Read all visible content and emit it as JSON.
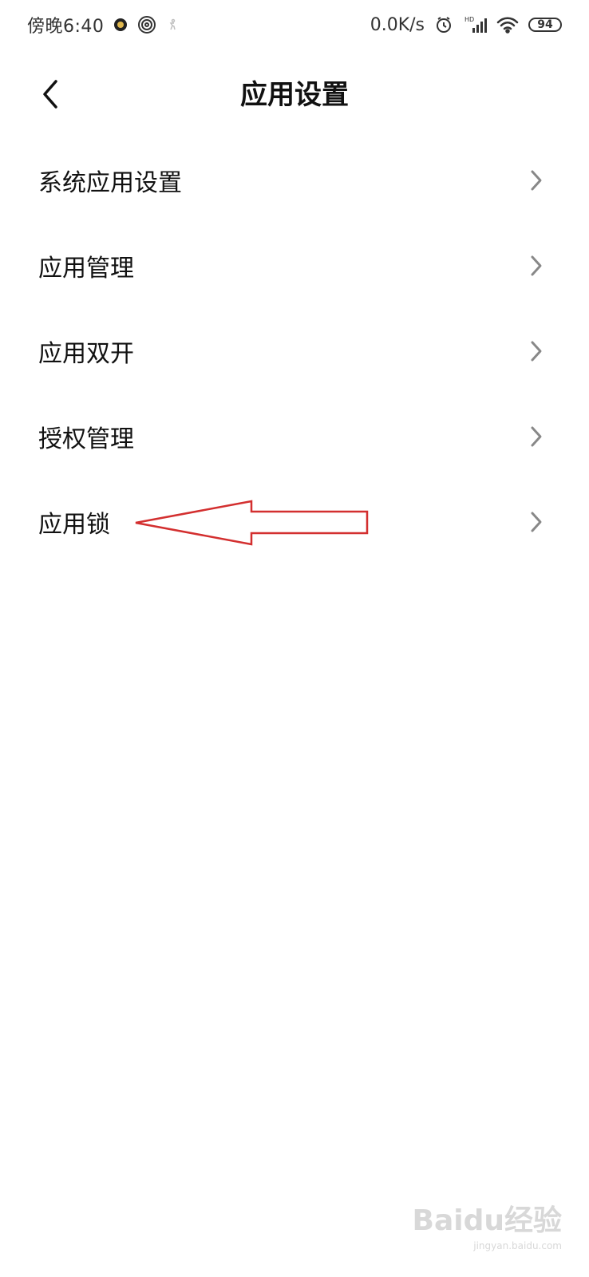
{
  "status_bar": {
    "time": "傍晚6:40",
    "net_speed": "0.0K/s",
    "network_badge": "HD",
    "battery_level": "94"
  },
  "header": {
    "title": "应用设置"
  },
  "menu": {
    "items": [
      {
        "label": "系统应用设置"
      },
      {
        "label": "应用管理"
      },
      {
        "label": "应用双开"
      },
      {
        "label": "授权管理"
      },
      {
        "label": "应用锁"
      }
    ]
  },
  "annotation": {
    "color": "#d32f2f"
  },
  "watermark": {
    "logo_text": "Baidu经验",
    "sub_text": "jingyan.baidu.com"
  }
}
